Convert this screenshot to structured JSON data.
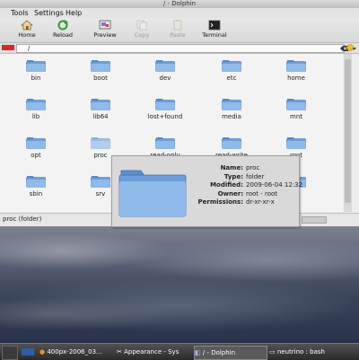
{
  "window": {
    "title": "/ - Dolphin"
  },
  "menu": [
    "Tools",
    "Settings",
    "Help"
  ],
  "toolbar": [
    {
      "label": "Home",
      "icon": "home-icon"
    },
    {
      "label": "Reload",
      "icon": "reload-icon"
    },
    {
      "label": "Preview",
      "icon": "preview-icon"
    },
    {
      "label": "Copy",
      "icon": "copy-icon",
      "disabled": true
    },
    {
      "label": "Paste",
      "icon": "paste-icon",
      "disabled": true
    },
    {
      "label": "Terminal",
      "icon": "terminal-icon"
    }
  ],
  "location": {
    "path": "/"
  },
  "folders": [
    {
      "name": "bin"
    },
    {
      "name": "boot"
    },
    {
      "name": "dev"
    },
    {
      "name": "etc"
    },
    {
      "name": "home"
    },
    {
      "name": "lib"
    },
    {
      "name": "lib64"
    },
    {
      "name": "lost+found"
    },
    {
      "name": "media"
    },
    {
      "name": "mnt"
    },
    {
      "name": "opt"
    },
    {
      "name": "proc",
      "selected": true
    },
    {
      "name": "read-only"
    },
    {
      "name": "read-write"
    },
    {
      "name": "root"
    },
    {
      "name": "sbin"
    },
    {
      "name": "srv"
    },
    {
      "name": ""
    },
    {
      "name": ""
    },
    {
      "name": "r"
    }
  ],
  "tooltip": {
    "name": {
      "key": "Name:",
      "value": "proc"
    },
    "type": {
      "key": "Type:",
      "value": "folder"
    },
    "modified": {
      "key": "Modified:",
      "value": "2009-06-04 12:32"
    },
    "owner": {
      "key": "Owner:",
      "value": "root - root"
    },
    "permissions": {
      "key": "Permissions:",
      "value": "dr-xr-xr-x"
    }
  },
  "status": {
    "text": "proc (folder)"
  },
  "taskbar": [
    {
      "label": "400px-2006_03...",
      "icon": "firefox-icon"
    },
    {
      "label": "Appearance - Sys",
      "icon": "tools-icon"
    },
    {
      "label": "/ - Dolphin",
      "icon": "dolphin-icon",
      "active": true
    },
    {
      "label": "neutrino : bash",
      "icon": "terminal-icon"
    }
  ],
  "colors": {
    "folder": "#7aa9e0",
    "selection_red": "#d8262b",
    "accent_green": "#2e9c2e"
  }
}
